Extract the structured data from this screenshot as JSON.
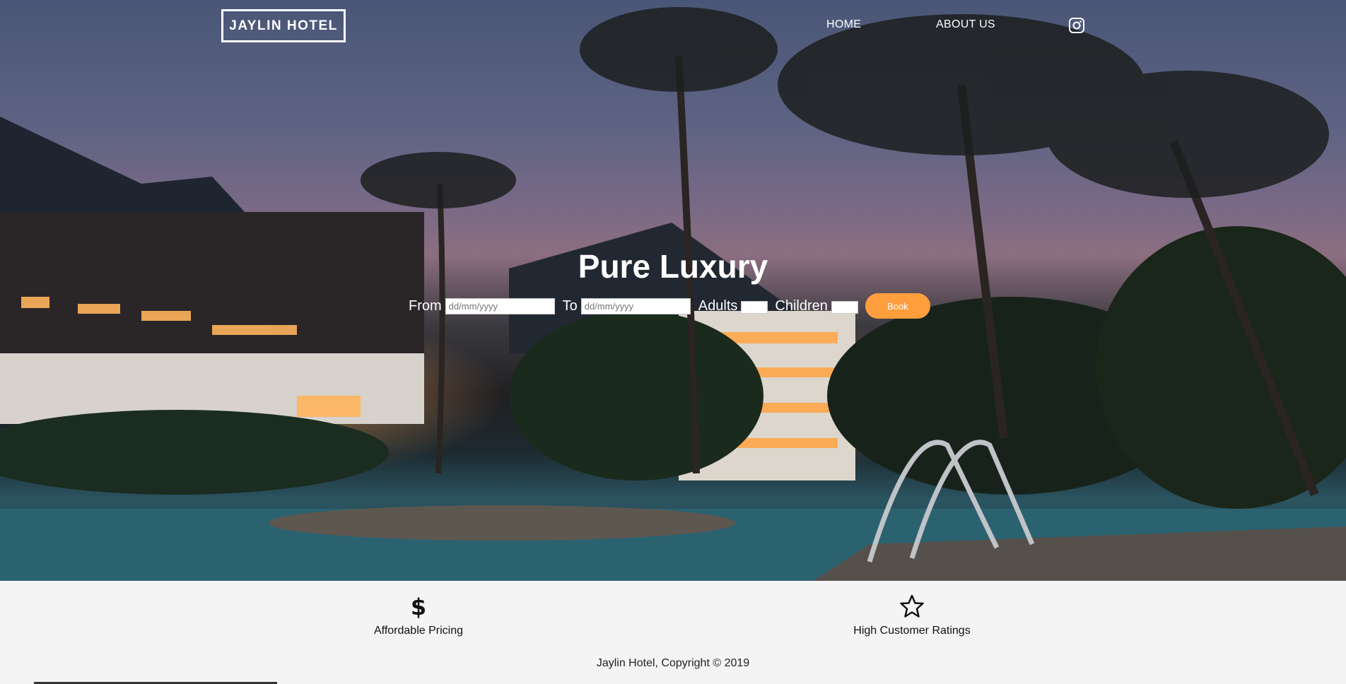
{
  "nav": {
    "logo": "JAYLIN HOTEL",
    "links": [
      "HOME",
      "ABOUT US"
    ],
    "social_icon": "instagram-icon"
  },
  "hero": {
    "headline": "Pure Luxury",
    "booking": {
      "from_label": "From",
      "from_placeholder": "dd/mm/yyyy",
      "to_label": "To",
      "to_placeholder": "dd/mm/yyyy",
      "adults_label": "Adults",
      "children_label": "Children",
      "book_label": "Book",
      "button_color": "#ff9e3d"
    }
  },
  "features": [
    {
      "icon": "dollar-icon",
      "title": "Affordable Pricing"
    },
    {
      "icon": "star-icon",
      "title": "High Customer Ratings"
    }
  ],
  "footer": {
    "copyright": "Jaylin Hotel, Copyright © 2019"
  }
}
